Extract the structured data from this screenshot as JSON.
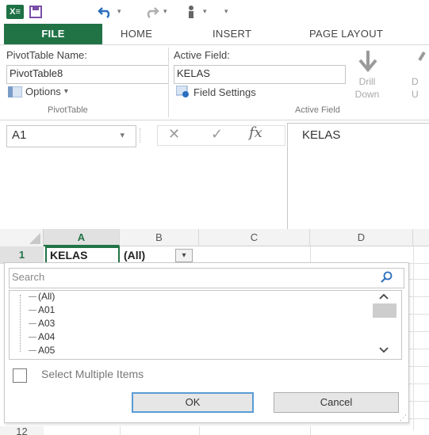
{
  "qat": {
    "excel_icon": "excel-icon",
    "dropdown_glyph": "▾"
  },
  "tabs": [
    "FILE",
    "HOME",
    "INSERT",
    "PAGE LAYOUT"
  ],
  "ribbon": {
    "pivot_name_label": "PivotTable Name:",
    "pivot_name_value": "PivotTable8",
    "options_label": "Options",
    "group_pivottable": "PivotTable",
    "active_field_label": "Active Field:",
    "active_field_value": "KELAS",
    "field_settings_label": "Field Settings",
    "group_active_field": "Active Field",
    "drill_down_line1": "Drill",
    "drill_down_line2": "Down",
    "drill_up_line1": "D",
    "drill_up_line2": "U"
  },
  "formula_bar": {
    "name_box": "A1",
    "content": "KELAS"
  },
  "grid": {
    "columns": [
      "A",
      "B",
      "C",
      "D"
    ],
    "row1_header": "1",
    "a1": "KELAS",
    "b1": "(All)",
    "last_row_header": "12"
  },
  "filter": {
    "search_placeholder": "Search",
    "items": [
      "(All)",
      "A01",
      "A03",
      "A04",
      "A05"
    ],
    "select_multiple_label": "Select Multiple Items",
    "ok_label": "OK",
    "cancel_label": "Cancel"
  }
}
